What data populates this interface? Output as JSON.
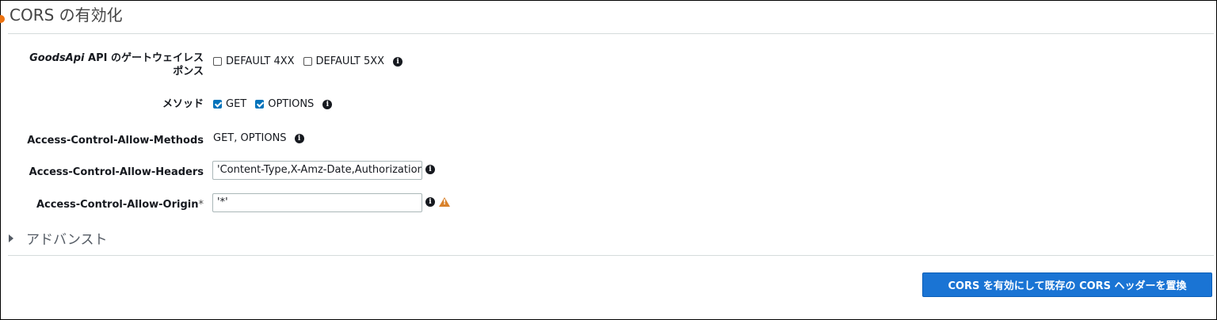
{
  "panel": {
    "title": "CORS の有効化",
    "advanced_label": "アドバンスト"
  },
  "rows": {
    "gateway_responses": {
      "label_prefix": "GoodsApi",
      "label_rest": " API のゲートウェイレス",
      "label_line2": "ポンス",
      "options": [
        {
          "label": "DEFAULT 4XX",
          "checked": false
        },
        {
          "label": "DEFAULT 5XX",
          "checked": false
        }
      ]
    },
    "methods": {
      "label": "メソッド",
      "options": [
        {
          "label": "GET",
          "checked": true
        },
        {
          "label": "OPTIONS",
          "checked": true
        }
      ]
    },
    "allow_methods": {
      "label": "Access-Control-Allow-Methods",
      "value": "GET, OPTIONS"
    },
    "allow_headers": {
      "label": "Access-Control-Allow-Headers",
      "value": "'Content-Type,X-Amz-Date,Authorization,X-Api-Key,X-Amz-Security-Token'"
    },
    "allow_origin": {
      "label": "Access-Control-Allow-Origin",
      "required_marker": "*",
      "value": "'*'"
    }
  },
  "actions": {
    "submit_label": "CORS を有効にして既存の CORS ヘッダーを置換"
  },
  "icons": {
    "info": "info-icon",
    "warning": "warning-icon",
    "caret": "caret-right-icon"
  },
  "colors": {
    "primary": "#1a74d4",
    "checkbox_checked": "#0073bb",
    "warning": "#d9822b",
    "accent_dot": "#ec7211"
  }
}
